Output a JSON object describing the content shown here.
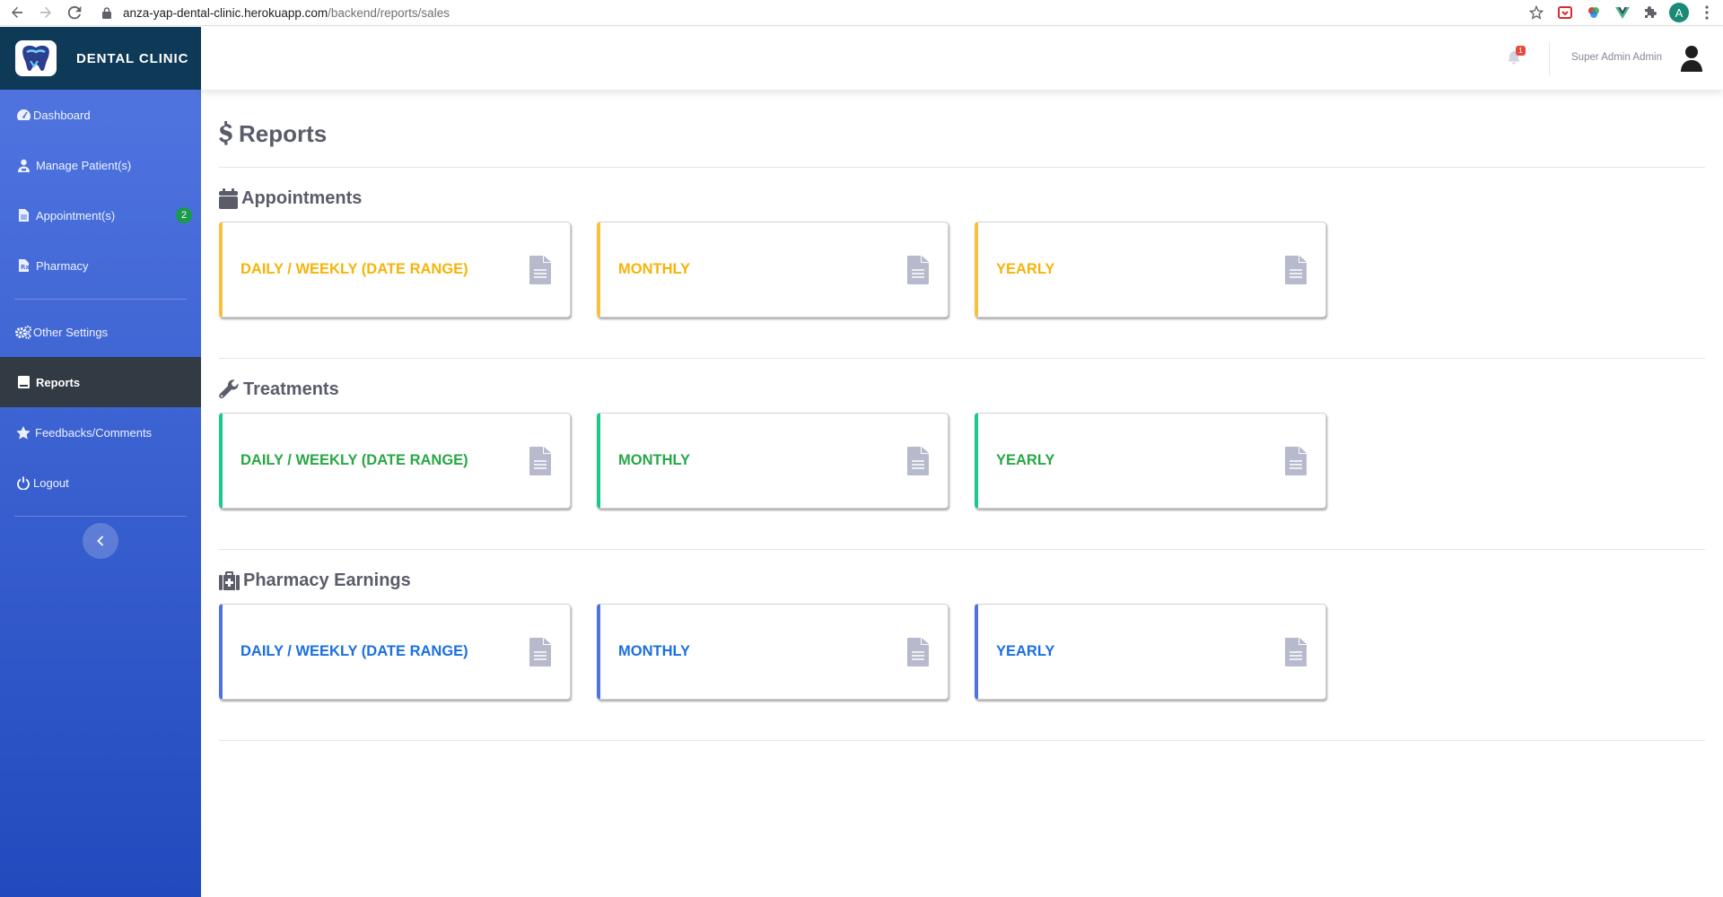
{
  "browser": {
    "url_host": "anza-yap-dental-clinic.herokuapp.com",
    "url_path": "/backend/reports/sales",
    "profile_initial": "A"
  },
  "sidebar": {
    "brand": "DENTAL CLINIC",
    "items": [
      {
        "label": "Dashboard",
        "icon": "tachometer-icon"
      },
      {
        "label": "Manage Patient(s)",
        "icon": "user-injured-icon"
      },
      {
        "label": "Appointment(s)",
        "icon": "file-icon",
        "badge": "2"
      },
      {
        "label": "Pharmacy",
        "icon": "prescription-icon"
      },
      {
        "label": "Other Settings",
        "icon": "cogs-icon"
      },
      {
        "label": "Reports",
        "icon": "book-icon",
        "active": true
      },
      {
        "label": "Feedbacks/Comments",
        "icon": "star-icon"
      },
      {
        "label": "Logout",
        "icon": "power-icon"
      }
    ]
  },
  "topbar": {
    "notification_count": "1",
    "user_name": "Super Admin Admin"
  },
  "page": {
    "title": "Reports"
  },
  "sections": [
    {
      "title": "Appointments",
      "icon": "calendar-icon",
      "color": "#f6c23e",
      "cards": [
        "DAILY / WEEKLY (DATE RANGE)",
        "MONTHLY",
        "YEARLY"
      ]
    },
    {
      "title": "Treatments",
      "icon": "wrench-icon",
      "color": "#1cc88a",
      "cards": [
        "DAILY / WEEKLY (DATE RANGE)",
        "MONTHLY",
        "YEARLY"
      ]
    },
    {
      "title": "Pharmacy Earnings",
      "icon": "medkit-icon",
      "color": "#4e73df",
      "cards": [
        "DAILY / WEEKLY (DATE RANGE)",
        "MONTHLY",
        "YEARLY"
      ]
    }
  ],
  "colors": {
    "appointments_text": "#f6b40a",
    "treatments_text": "#28a745",
    "pharmacy_text": "#1b6fe0"
  }
}
